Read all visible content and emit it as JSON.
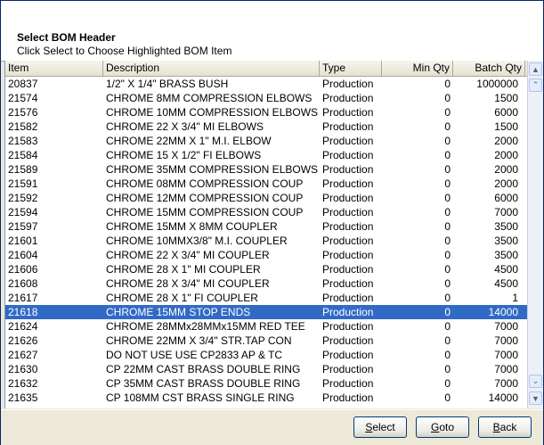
{
  "header": {
    "title": "Select BOM Header",
    "subtitle": "Click Select to Choose Highlighted BOM Item"
  },
  "columns": {
    "item": "Item",
    "description": "Description",
    "type": "Type",
    "min_qty": "Min Qty",
    "batch_qty": "Batch Qty"
  },
  "rows": [
    {
      "item": "20837",
      "description": "1/2\" X 1/4\" BRASS BUSH",
      "type": "Production",
      "min_qty": "0",
      "batch_qty": "1000000"
    },
    {
      "item": "21574",
      "description": "CHROME  8MM COMPRESSION ELBOWS",
      "type": "Production",
      "min_qty": "0",
      "batch_qty": "1500"
    },
    {
      "item": "21576",
      "description": "CHROME 10MM COMPRESSION ELBOWS",
      "type": "Production",
      "min_qty": "0",
      "batch_qty": "6000"
    },
    {
      "item": "21582",
      "description": "CHROME 22 X 3/4\" MI ELBOWS",
      "type": "Production",
      "min_qty": "0",
      "batch_qty": "1500"
    },
    {
      "item": "21583",
      "description": "CHROME 22MM X 1\" M.I. ELBOW",
      "type": "Production",
      "min_qty": "0",
      "batch_qty": "2000"
    },
    {
      "item": "21584",
      "description": "CHROME 15 X 1/2\" FI ELBOWS",
      "type": "Production",
      "min_qty": "0",
      "batch_qty": "2000"
    },
    {
      "item": "21589",
      "description": "CHROME 35MM COMPRESSION ELBOWS",
      "type": "Production",
      "min_qty": "0",
      "batch_qty": "2000"
    },
    {
      "item": "21591",
      "description": "CHROME 08MM COMPRESSION COUP",
      "type": "Production",
      "min_qty": "0",
      "batch_qty": "2000"
    },
    {
      "item": "21592",
      "description": "CHROME 12MM COMPRESSION COUP",
      "type": "Production",
      "min_qty": "0",
      "batch_qty": "6000"
    },
    {
      "item": "21594",
      "description": "CHROME 15MM COMPRESSION COUP",
      "type": "Production",
      "min_qty": "0",
      "batch_qty": "7000"
    },
    {
      "item": "21597",
      "description": "CHROME 15MM X 8MM COUPLER",
      "type": "Production",
      "min_qty": "0",
      "batch_qty": "3500"
    },
    {
      "item": "21601",
      "description": "CHROME 10MMX3/8\" M.I. COUPLER",
      "type": "Production",
      "min_qty": "0",
      "batch_qty": "3500"
    },
    {
      "item": "21604",
      "description": "CHROME 22 X 3/4\" MI COUPLER",
      "type": "Production",
      "min_qty": "0",
      "batch_qty": "3500"
    },
    {
      "item": "21606",
      "description": "CHROME 28 X  1\"  MI COUPLER",
      "type": "Production",
      "min_qty": "0",
      "batch_qty": "4500"
    },
    {
      "item": "21608",
      "description": "CHROME 28 X 3/4\" MI COUPLER",
      "type": "Production",
      "min_qty": "0",
      "batch_qty": "4500"
    },
    {
      "item": "21617",
      "description": "CHROME 28 X  1\"  FI COUPLER",
      "type": "Production",
      "min_qty": "0",
      "batch_qty": "1"
    },
    {
      "item": "21618",
      "description": "CHROME 15MM STOP ENDS",
      "type": "Production",
      "min_qty": "0",
      "batch_qty": "14000",
      "selected": true
    },
    {
      "item": "21624",
      "description": "CHROME 28MMx28MMx15MM RED TEE",
      "type": "Production",
      "min_qty": "0",
      "batch_qty": "7000"
    },
    {
      "item": "21626",
      "description": "CHROME 22MM X 3/4\" STR.TAP CON",
      "type": "Production",
      "min_qty": "0",
      "batch_qty": "7000"
    },
    {
      "item": "21627",
      "description": "DO NOT USE USE CP2833 AP & TC",
      "type": "Production",
      "min_qty": "0",
      "batch_qty": "7000"
    },
    {
      "item": "21630",
      "description": "CP 22MM CAST BRASS DOUBLE RING",
      "type": "Production",
      "min_qty": "0",
      "batch_qty": "7000"
    },
    {
      "item": "21632",
      "description": "CP 35MM CAST BRASS DOUBLE RING",
      "type": "Production",
      "min_qty": "0",
      "batch_qty": "7000"
    },
    {
      "item": "21635",
      "description": "CP 108MM CST BRASS SINGLE RING",
      "type": "Production",
      "min_qty": "0",
      "batch_qty": "14000"
    }
  ],
  "scrollbar": {
    "icons": [
      "scroll-up-icon",
      "page-up-icon",
      "page-down-icon",
      "scroll-down-icon"
    ]
  },
  "buttons": {
    "select": {
      "pre": "",
      "key": "S",
      "post": "elect"
    },
    "goto": {
      "pre": "",
      "key": "G",
      "post": "oto"
    },
    "back": {
      "pre": "",
      "key": "B",
      "post": "ack"
    }
  },
  "colors": {
    "selection": "#316ac5",
    "header_bg": "#ffffff",
    "dialog_bg": "#ece9d8"
  }
}
